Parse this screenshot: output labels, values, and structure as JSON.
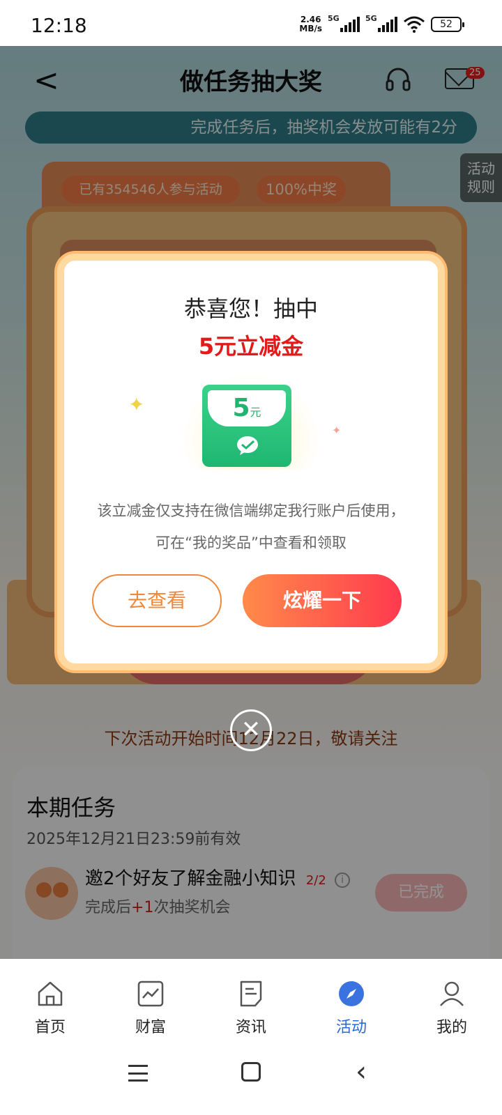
{
  "status_bar": {
    "time": "12:18",
    "net_speed_value": "2.46",
    "net_speed_unit": "MB/s",
    "sim1": "5G",
    "sim2": "5G",
    "battery": "52"
  },
  "header": {
    "back_glyph": "<",
    "title": "做任务抽大奖",
    "mail_badge": "25"
  },
  "notice": "完成任务后，抽奖机会发放可能有2分",
  "rules_tab": {
    "line1": "活动",
    "line2": "规则"
  },
  "machine": {
    "participants": "已有354546人参与活动",
    "win_rate": "100%中奖"
  },
  "next_activity": "下次活动开始时间12月22日，敬请关注",
  "tasks": {
    "heading": "本期任务",
    "deadline": "2025年12月21日23:59前有效",
    "items": [
      {
        "name": "邀2个好友了解金融小知识",
        "progress": "2/2",
        "reward_prefix": "完成后",
        "reward_plus": "+1",
        "reward_suffix": "次抽奖机会",
        "button": "已完成"
      }
    ]
  },
  "modal": {
    "title": "恭喜您！抽中",
    "prize": "5元立减金",
    "coupon_amount": "5",
    "coupon_unit": "元",
    "desc_line1": "该立减金仅支持在微信端绑定我行账户后使用，",
    "desc_line2": "可在“我的奖品”中查看和领取",
    "btn_view": "去查看",
    "btn_share": "炫耀一下",
    "close_glyph": "✕"
  },
  "tab_bar": {
    "items": [
      {
        "label": "首页",
        "icon": "home-icon"
      },
      {
        "label": "财富",
        "icon": "wealth-chart-icon"
      },
      {
        "label": "资讯",
        "icon": "news-icon"
      },
      {
        "label": "活动",
        "icon": "compass-icon",
        "active": true
      },
      {
        "label": "我的",
        "icon": "profile-icon"
      }
    ]
  },
  "colors": {
    "accent_red": "#e21a1a",
    "tab_active": "#2a68d8",
    "coupon_green": "#1eb772",
    "share_gradient_end": "#ff3a4e"
  }
}
